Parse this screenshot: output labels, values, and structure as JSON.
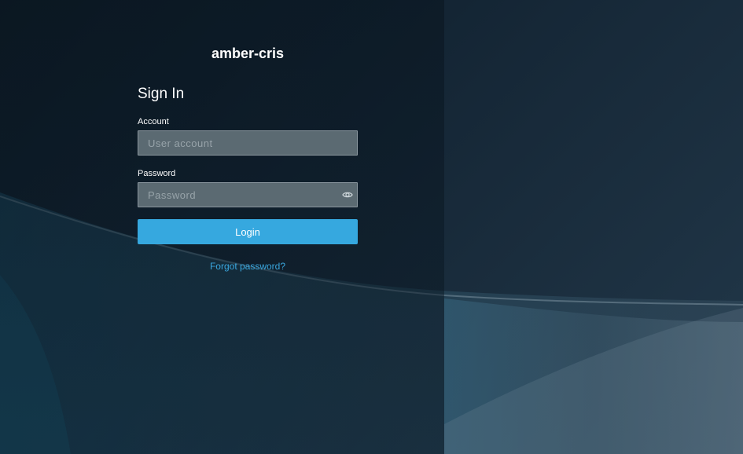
{
  "app_name": "amber-cris",
  "signin": {
    "title": "Sign In",
    "account_label": "Account",
    "account_placeholder": "User account",
    "account_value": "",
    "password_label": "Password",
    "password_placeholder": "Password",
    "password_value": "",
    "login_label": "Login",
    "forgot_label": "Forgot password?"
  },
  "icons": {
    "password_toggle": "eye-icon"
  },
  "colors": {
    "background": "#132433",
    "input_background": "#5b6a72",
    "input_border": "#8a969e",
    "accent": "#36a8df",
    "link": "#3aa7df",
    "text": "#ffffff"
  }
}
